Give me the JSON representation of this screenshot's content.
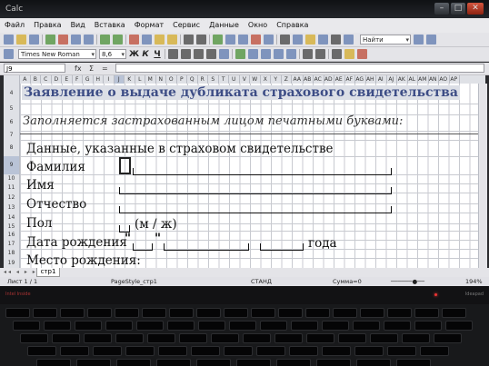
{
  "window": {
    "title": "Calc"
  },
  "menu": [
    "Файл",
    "Правка",
    "Вид",
    "Вставка",
    "Формат",
    "Сервис",
    "Данные",
    "Окно",
    "Справка"
  ],
  "toolbar": {
    "search_placeholder": "Найти",
    "font_name": "Times New Roman",
    "font_size": "8,6"
  },
  "formula_bar": {
    "cell_ref": "J9",
    "fx": "fx",
    "sum": "Σ",
    "eq": "="
  },
  "columns": [
    "A",
    "B",
    "C",
    "D",
    "E",
    "F",
    "G",
    "H",
    "I",
    "J",
    "K",
    "L",
    "M",
    "N",
    "O",
    "P",
    "Q",
    "R",
    "S",
    "T",
    "U",
    "V",
    "W",
    "X",
    "Y",
    "Z",
    "AA",
    "AB",
    "AC",
    "AD",
    "AE",
    "AF",
    "AG",
    "AH",
    "AI",
    "AJ",
    "AK",
    "AL",
    "AM",
    "AN",
    "AO",
    "AP"
  ],
  "selected_column": "J",
  "rows": [
    "4",
    "5",
    "6",
    "7",
    "8",
    "9",
    "10",
    "11",
    "12",
    "13",
    "14",
    "15",
    "16",
    "17",
    "18",
    "19"
  ],
  "selected_row": "9",
  "document": {
    "heading_bold": "Заявление",
    "heading_rest": " о выдаче дубликата страхового свидетельства",
    "instruction": "Заполняется застрахованным лицом печатными буквами:",
    "section": "Данные, указанные в страховом свидетельстве",
    "lastname": "Фамилия",
    "firstname": "Имя",
    "patronymic": "Отчество",
    "sex": "Пол",
    "sex_hint": "(м / ж)",
    "birthdate": "Дата рождения",
    "quote_open": "\"",
    "quote_close": "\"",
    "year_word": "года",
    "birthplace": "Место рождения:"
  },
  "sheet_tab": "стр1",
  "status": {
    "sheet": "Лист 1 / 1",
    "page_style": "PageStyle_стр1",
    "mode": "СТАНД",
    "sum": "Сумма=0",
    "zoom": "194%"
  },
  "bezel": {
    "left": "Intel Inside",
    "right": "Ideapad"
  }
}
